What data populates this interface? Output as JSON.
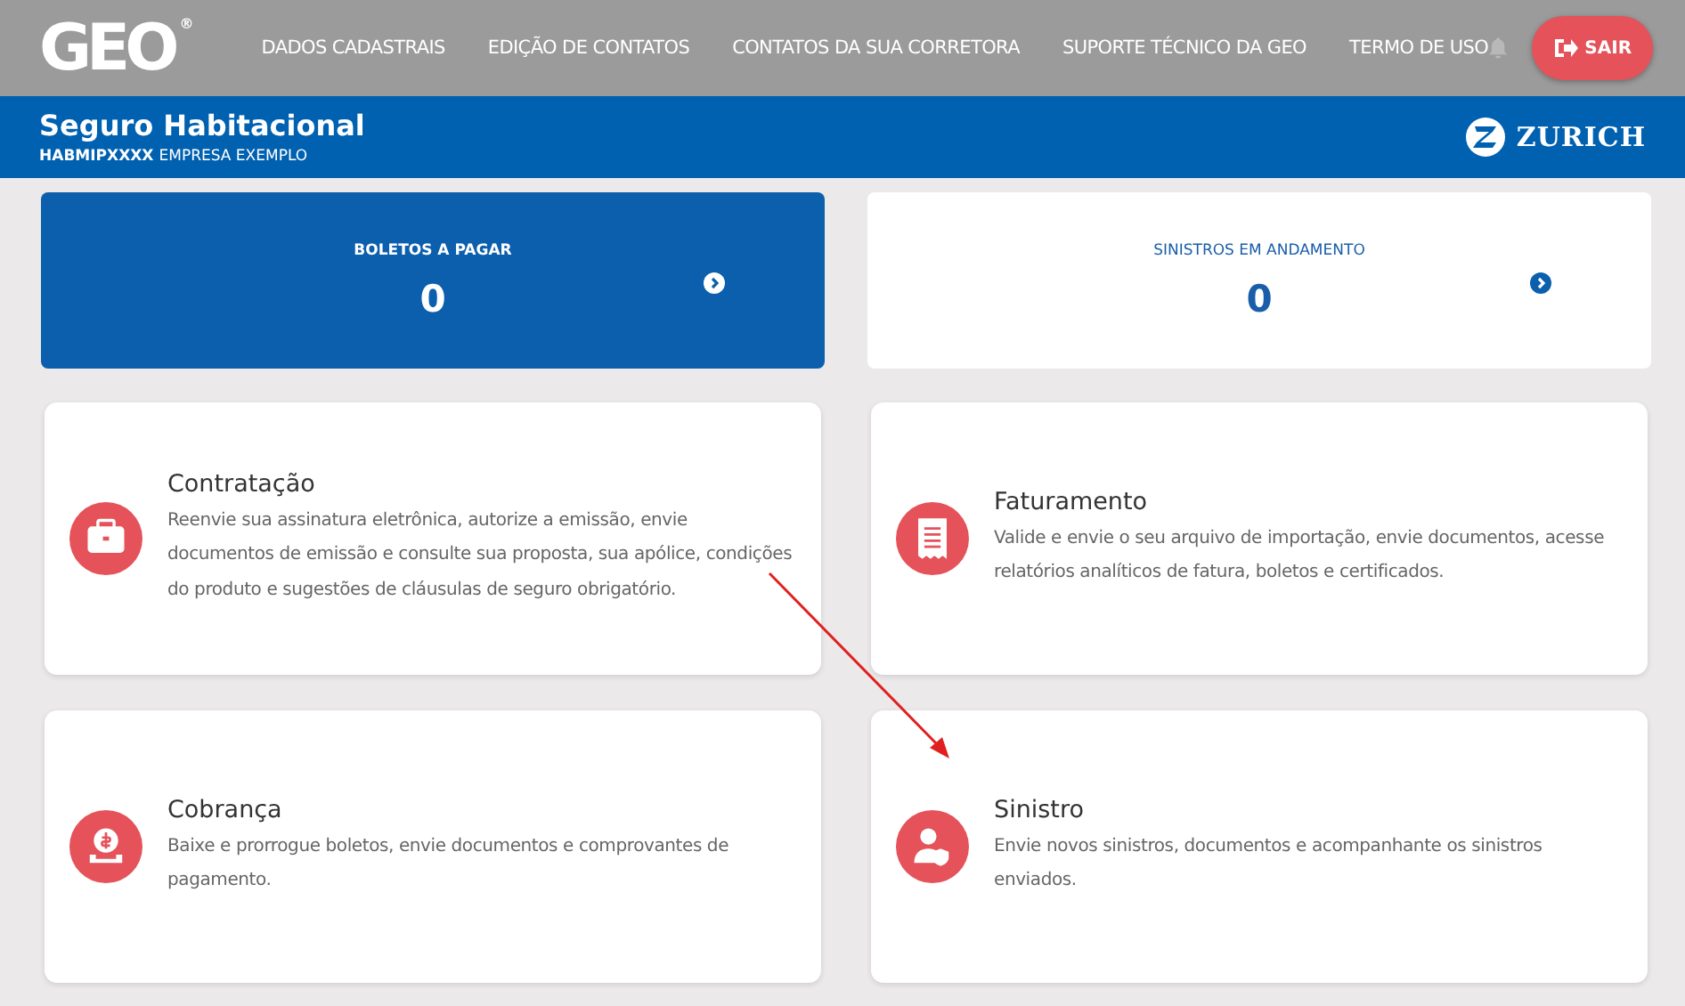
{
  "top_bar": {
    "logo": "GEO",
    "logo_mark": "®",
    "nav": [
      {
        "label": "DADOS CADASTRAIS"
      },
      {
        "label": "EDIÇÃO DE CONTATOS"
      },
      {
        "label": "CONTATOS DA SUA CORRETORA"
      },
      {
        "label": "SUPORTE TÉCNICO DA GEO"
      },
      {
        "label": "TERMO DE USO"
      }
    ],
    "logout_button": "SAIR"
  },
  "header": {
    "title": "Seguro Habitacional",
    "code": "HABMIPXXXX",
    "company": "EMPRESA EXEMPLO",
    "brand": "ZURICH"
  },
  "summary_cards": [
    {
      "label": "BOLETOS A PAGAR",
      "count": "0",
      "highlighted": true
    },
    {
      "label": "SINISTROS EM ANDAMENTO",
      "count": "0",
      "highlighted": false
    }
  ],
  "feature_cards": [
    {
      "title": "Contratação",
      "description": "Reenvie sua assinatura eletrônica, autorize a emissão, envie documentos de emissão e consulte sua proposta, sua apólice, condições do produto e sugestões de cláusulas de seguro obrigatório."
    },
    {
      "title": "Faturamento",
      "description": "Valide e envie o seu arquivo de importação, envie documentos, acesse relatórios analíticos de fatura, boletos e certificados."
    },
    {
      "title": "Cobrança",
      "description": "Baixe e prorrogue boletos, envie documentos e comprovantes de pagamento."
    },
    {
      "title": "Sinistro",
      "description": "Envie novos sinistros, documentos e acompanhante os sinistros enviados."
    }
  ]
}
